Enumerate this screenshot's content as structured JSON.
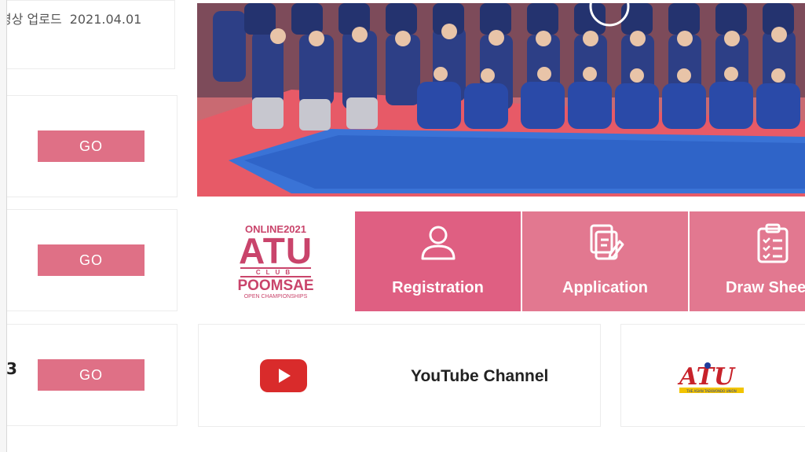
{
  "notice": {
    "text": "영상 업로드",
    "date": "2021.04.01"
  },
  "side_char": "3",
  "buttons": {
    "go1": "GO",
    "go2": "GO",
    "go3": "GO"
  },
  "logo": {
    "top": "ONLINE2021",
    "atu": "ATU",
    "club": "CLUB",
    "poomsae": "POOMSAE",
    "open": "OPEN CHAMPIONSHIPS"
  },
  "tiles": [
    {
      "label": "Registration",
      "icon": "user-icon",
      "color": "#df5f82"
    },
    {
      "label": "Application",
      "icon": "edit-document-icon",
      "color": "#e27890"
    },
    {
      "label": "Draw Shee",
      "icon": "clipboard-checklist-icon",
      "color": "#e27890"
    }
  ],
  "youtube": {
    "label": "YouTube Channel",
    "icon": "youtube-play-icon"
  },
  "atu_logo": {
    "text": "ATU",
    "caption": "THE ASIAN TAEKWONDO UNION"
  },
  "colors": {
    "accent": "#df7086",
    "blue_mat": "#3a73d6",
    "red_floor": "#e45a68"
  }
}
